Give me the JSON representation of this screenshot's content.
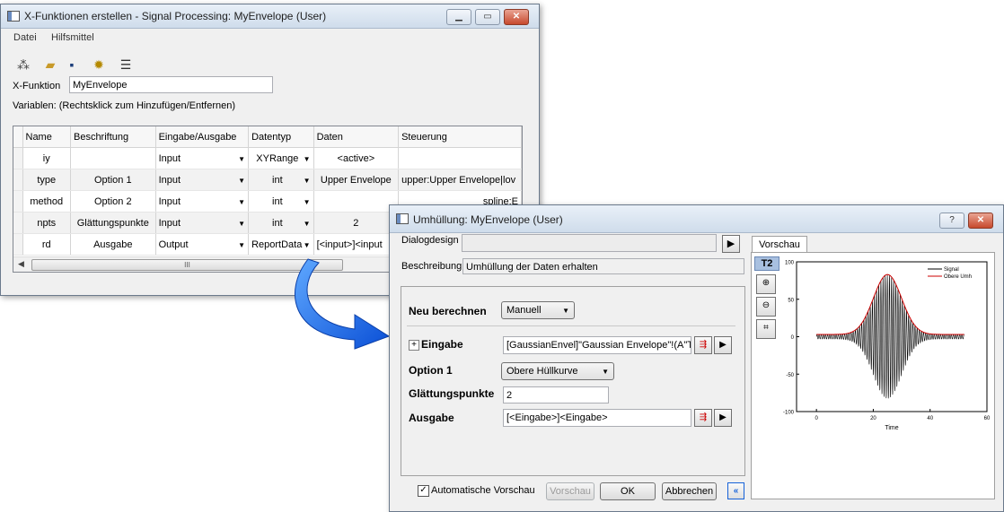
{
  "xf_window": {
    "title": "X-Funktionen erstellen - Signal Processing: MyEnvelope (User)",
    "menu": [
      "Datei",
      "Hilfsmittel"
    ],
    "xfunction_label": "X-Funktion",
    "xfunction_value": "MyEnvelope",
    "variables_label": "Variablen: (Rechtsklick zum Hinzufügen/Entfernen)",
    "columns": [
      "Name",
      "Beschriftung",
      "Eingabe/Ausgabe",
      "Datentyp",
      "Daten",
      "Steuerung"
    ],
    "rows": [
      {
        "name": "iy",
        "label": "",
        "io": "Input",
        "type": "XYRange",
        "data": "<active>",
        "control": ""
      },
      {
        "name": "type",
        "label": "Option 1",
        "io": "Input",
        "type": "int",
        "data": "Upper Envelope",
        "control": "upper:Upper Envelope|lov"
      },
      {
        "name": "method",
        "label": "Option 2",
        "io": "Input",
        "type": "int",
        "data": "",
        "control": "spline:E"
      },
      {
        "name": "npts",
        "label": "Glättungspunkte",
        "io": "Input",
        "type": "int",
        "data": "2",
        "control": ""
      },
      {
        "name": "rd",
        "label": "Ausgabe",
        "io": "Output",
        "type": "ReportData",
        "data": "[<input>]<input",
        "control": ""
      }
    ],
    "scroll_grip": "III"
  },
  "dialog": {
    "title": "Umhüllung: MyEnvelope (User)",
    "dialogdesign_label": "Dialogdesign",
    "beschreibung_label": "Beschreibung",
    "beschreibung_value": "Umhüllung der Daten erhalten",
    "recalc_label": "Neu berechnen",
    "recalc_value": "Manuell",
    "input_label": "Eingabe",
    "input_value": "[GaussianEnvel]\"Gaussian Envelope\"!(A\"Ti",
    "option1_label": "Option 1",
    "option1_value": "Obere Hüllkurve",
    "smooth_label": "Glättungspunkte",
    "smooth_value": "2",
    "output_label": "Ausgabe",
    "output_value": "[<Eingabe>]<Eingabe>",
    "auto_preview_label": "Automatische Vorschau",
    "auto_preview_checked": true,
    "preview_button": "Vorschau",
    "ok_button": "OK",
    "cancel_button": "Abbrechen",
    "preview_tab": "Vorschau",
    "t2_label": "T2"
  },
  "chart_data": {
    "type": "line",
    "xlabel": "Time",
    "xticks": [
      0,
      20,
      40,
      60
    ],
    "yticks": [
      100,
      50,
      0,
      -50,
      -100
    ],
    "xlim": [
      -7,
      60
    ],
    "ylim": [
      -100,
      100
    ],
    "series": [
      {
        "name": "Signal",
        "color": "#000000",
        "description_values": "oscillating signal with Gaussian envelope, amplitude 80 centered at x=25"
      },
      {
        "name": "Obere Umh",
        "color": "#cc0000"
      }
    ],
    "signal_center": 25,
    "signal_amplitude": 80,
    "signal_baseline": 0
  }
}
